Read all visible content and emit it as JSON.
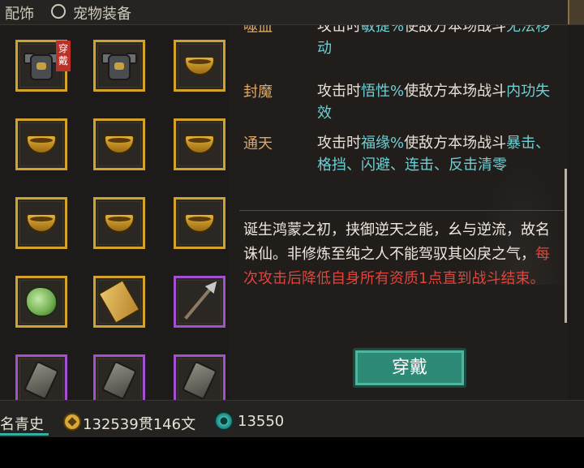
{
  "tabs": {
    "accessories": "配饰",
    "pet_equipment": "宠物装备"
  },
  "grid": {
    "badge_equipped": "穿戴",
    "slots": [
      {
        "icon": "armor-icon",
        "rarity": "gold",
        "equipped": true
      },
      {
        "icon": "armor-icon",
        "rarity": "gold",
        "equipped": false
      },
      {
        "icon": "bowl-icon",
        "rarity": "gold",
        "equipped": false
      },
      {
        "icon": "bowl-icon",
        "rarity": "gold",
        "equipped": false
      },
      {
        "icon": "bowl-icon",
        "rarity": "gold",
        "equipped": false
      },
      {
        "icon": "bowl-icon",
        "rarity": "gold",
        "equipped": false
      },
      {
        "icon": "bowl-icon",
        "rarity": "gold",
        "equipped": false
      },
      {
        "icon": "bowl-icon",
        "rarity": "gold",
        "equipped": false
      },
      {
        "icon": "bowl-icon",
        "rarity": "gold",
        "equipped": false
      },
      {
        "icon": "cabbage-icon",
        "rarity": "gold",
        "equipped": false
      },
      {
        "icon": "card-icon",
        "rarity": "gold",
        "equipped": false
      },
      {
        "icon": "spear-icon",
        "rarity": "purple",
        "equipped": false
      },
      {
        "icon": "stone-icon",
        "rarity": "purple",
        "equipped": false
      },
      {
        "icon": "stone-icon",
        "rarity": "purple",
        "equipped": false
      },
      {
        "icon": "stone-icon",
        "rarity": "purple",
        "equipped": false
      }
    ]
  },
  "effects": [
    {
      "name": "噬血",
      "pre": "攻击时",
      "stat": "敏捷%",
      "mid": "使敌方本场战斗",
      "effect": "无法移动"
    },
    {
      "name": "封魔",
      "pre": "攻击时",
      "stat": "悟性%",
      "mid": "使敌方本场战斗",
      "effect": "内功失效"
    },
    {
      "name": "通天",
      "pre": "攻击时",
      "stat": "福缘%",
      "mid": "使敌方本场战斗",
      "effect": "暴击、格挡、闪避、连击、反击清零"
    }
  ],
  "lore": {
    "normal": "诞生鸿蒙之初，挟御逆天之能，幺与逆流，故名诛仙。非修炼至纯之人不能驾驭其凶戾之气，",
    "warning": "每次攻击后降低自身所有资质1点直到战斗结束。"
  },
  "equip_button": "穿戴",
  "status": {
    "fame": "名青史",
    "money": "132539贯146文",
    "jade": "13550"
  },
  "colors": {
    "gold_border": "#d4a12a",
    "purple_border": "#a24fd0",
    "highlight": "#6fd0d4",
    "warning": "#e0443a",
    "button": "#2d8a76"
  }
}
